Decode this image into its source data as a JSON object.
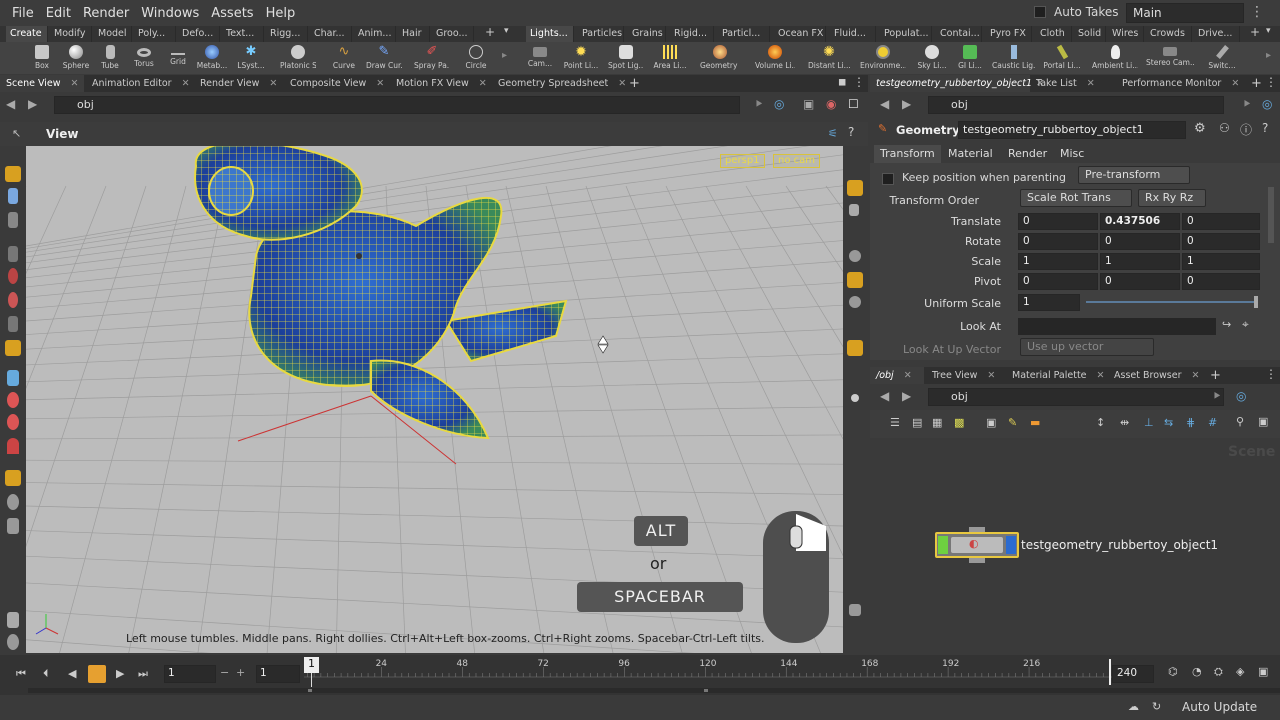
{
  "menu": [
    "File",
    "Edit",
    "Render",
    "Windows",
    "Assets",
    "Help"
  ],
  "auto_takes": "Auto Takes",
  "desktop": "Main",
  "shelf_left_tabs": [
    "Create",
    "Modify",
    "Model",
    "Poly...",
    "Defo...",
    "Text...",
    "Rigg...",
    "Char...",
    "Anim...",
    "Hair",
    "Groo..."
  ],
  "shelf_right_tabs": [
    "Lights...",
    "Particles",
    "Grains",
    "Rigid...",
    "Particl...",
    "Ocean FX",
    "Fluid...",
    "Populat...",
    "Contai...",
    "Pyro FX",
    "Cloth",
    "Solid",
    "Wires",
    "Crowds",
    "Drive..."
  ],
  "shelf_left_tools": [
    "Box",
    "Sphere",
    "Tube",
    "Torus",
    "Grid",
    "Metab...",
    "LSyst...",
    "Platonic Sol...",
    "Curve",
    "Draw Cur...",
    "Spray Pa...",
    "Circle"
  ],
  "shelf_right_tools": [
    "Cam...",
    "Point Li...",
    "Spot Lig...",
    "Area Li...",
    "Geometry L...",
    "Volume Li...",
    "Distant Li...",
    "Environme...",
    "Sky Li...",
    "GI Li...",
    "Caustic Lig...",
    "Portal Li...",
    "Ambient Li...",
    "Stereo Cam...",
    "Switc..."
  ],
  "left_pane_tabs": [
    "Scene View",
    "Animation Editor",
    "Render View",
    "Composite View",
    "Motion FX View",
    "Geometry Spreadsheet"
  ],
  "path": "obj",
  "view_title": "View",
  "viewport": {
    "persp": "persp1",
    "cam": "no cam",
    "hint": "Left mouse tumbles. Middle pans. Right dollies. Ctrl+Alt+Left box-zooms. Ctrl+Right zooms. Spacebar-Ctrl-Left tilts.",
    "key_alt": "ALT",
    "key_or": "or",
    "key_space": "SPACEBAR"
  },
  "right_pane_tabs": [
    "testgeometry_rubbertoy_object1",
    "Take List",
    "Performance Monitor"
  ],
  "params": {
    "type": "Geometry",
    "name": "testgeometry_rubbertoy_object1",
    "tabs": [
      "Transform",
      "Material",
      "Render",
      "Misc"
    ],
    "keep_position": "Keep position when parenting",
    "pretransform": "Pre-transform",
    "transform_order_label": "Transform Order",
    "transform_order": "Scale Rot Trans",
    "rot_order": "Rx Ry Rz",
    "rows": [
      {
        "label": "Translate",
        "x": "0",
        "y": "0.437506",
        "z": "0"
      },
      {
        "label": "Rotate",
        "x": "0",
        "y": "0",
        "z": "0"
      },
      {
        "label": "Scale",
        "x": "1",
        "y": "1",
        "z": "1"
      },
      {
        "label": "Pivot",
        "x": "0",
        "y": "0",
        "z": "0"
      }
    ],
    "uniform_scale_label": "Uniform Scale",
    "uniform_scale": "1",
    "look_at_label": "Look At",
    "look_up_label": "Look At Up Vector",
    "look_up_value": "Use up vector"
  },
  "network_tabs": [
    "/obj",
    "Tree View",
    "Material Palette",
    "Asset Browser"
  ],
  "network": {
    "watermark": "Scene",
    "node_name": "testgeometry_rubbertoy_object1"
  },
  "timeline": {
    "frame": "1",
    "start": "1",
    "end": "240",
    "ticks": [
      "24",
      "48",
      "72",
      "96",
      "120",
      "144",
      "168",
      "192",
      "216"
    ],
    "current_marker": "1"
  },
  "status": {
    "auto_update": "Auto Update"
  },
  "colors": {
    "wire": "#e8d940",
    "toy": "#1f4fb0",
    "accent": "#f0a030"
  }
}
